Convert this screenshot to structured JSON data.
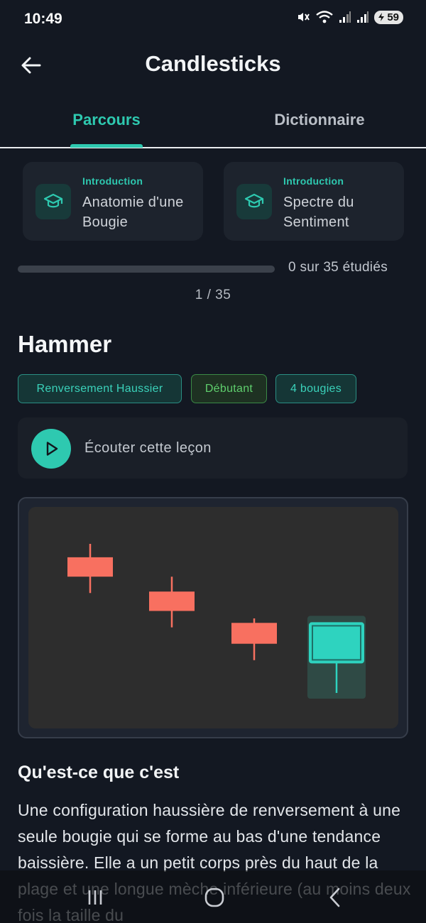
{
  "status_bar": {
    "time": "10:49",
    "battery": "59",
    "icons": [
      "mute-icon",
      "wifi-icon",
      "signal-icon",
      "signal-icon",
      "battery-icon"
    ]
  },
  "header": {
    "title": "Candlesticks",
    "back_icon": "arrow-left-icon"
  },
  "tabs": [
    {
      "label": "Parcours",
      "active": true
    },
    {
      "label": "Dictionnaire",
      "active": false
    }
  ],
  "lesson_cards": [
    {
      "kicker": "Introduction",
      "title": "Anatomie d'une Bougie",
      "icon": "graduation-cap-icon"
    },
    {
      "kicker": "Introduction",
      "title": "Spectre du Sentiment",
      "icon": "graduation-cap-icon"
    }
  ],
  "progress": {
    "label": "0 sur 35 étudiés",
    "studied": 0,
    "total": 35
  },
  "counter": "1 / 35",
  "pattern": {
    "name": "Hammer",
    "tags": [
      "Renversement Haussier",
      "Débutant",
      "4 bougies"
    ],
    "listen_label": "Écouter cette leçon",
    "play_icon": "play-icon"
  },
  "candles": {
    "colors": {
      "bearish": "#f87060",
      "bullish": "#2ed3bf",
      "highlight": "#2f4a45"
    },
    "items": [
      {
        "open": 9.1,
        "high": 10.0,
        "close": 7.8,
        "low": 6.7,
        "direction": "bearish"
      },
      {
        "open": 6.8,
        "high": 7.8,
        "close": 5.5,
        "low": 4.4,
        "direction": "bearish"
      },
      {
        "open": 4.7,
        "high": 5.0,
        "close": 3.3,
        "low": 2.2,
        "direction": "bearish"
      },
      {
        "open": 3.3,
        "high": 4.6,
        "close": 4.6,
        "low": 0.0,
        "direction": "bullish",
        "highlighted": true
      }
    ]
  },
  "description": {
    "title": "Qu'est-ce que c'est",
    "body": "Une configuration haussière de renversement à une seule bougie qui se forme au bas d'une tendance baissière. Elle a un petit corps près du haut de la plage et une longue mèche inférieure (au moins deux fois la taille du"
  },
  "nav_bar": {
    "icons": [
      "recent-apps-icon",
      "home-icon",
      "back-icon"
    ]
  }
}
